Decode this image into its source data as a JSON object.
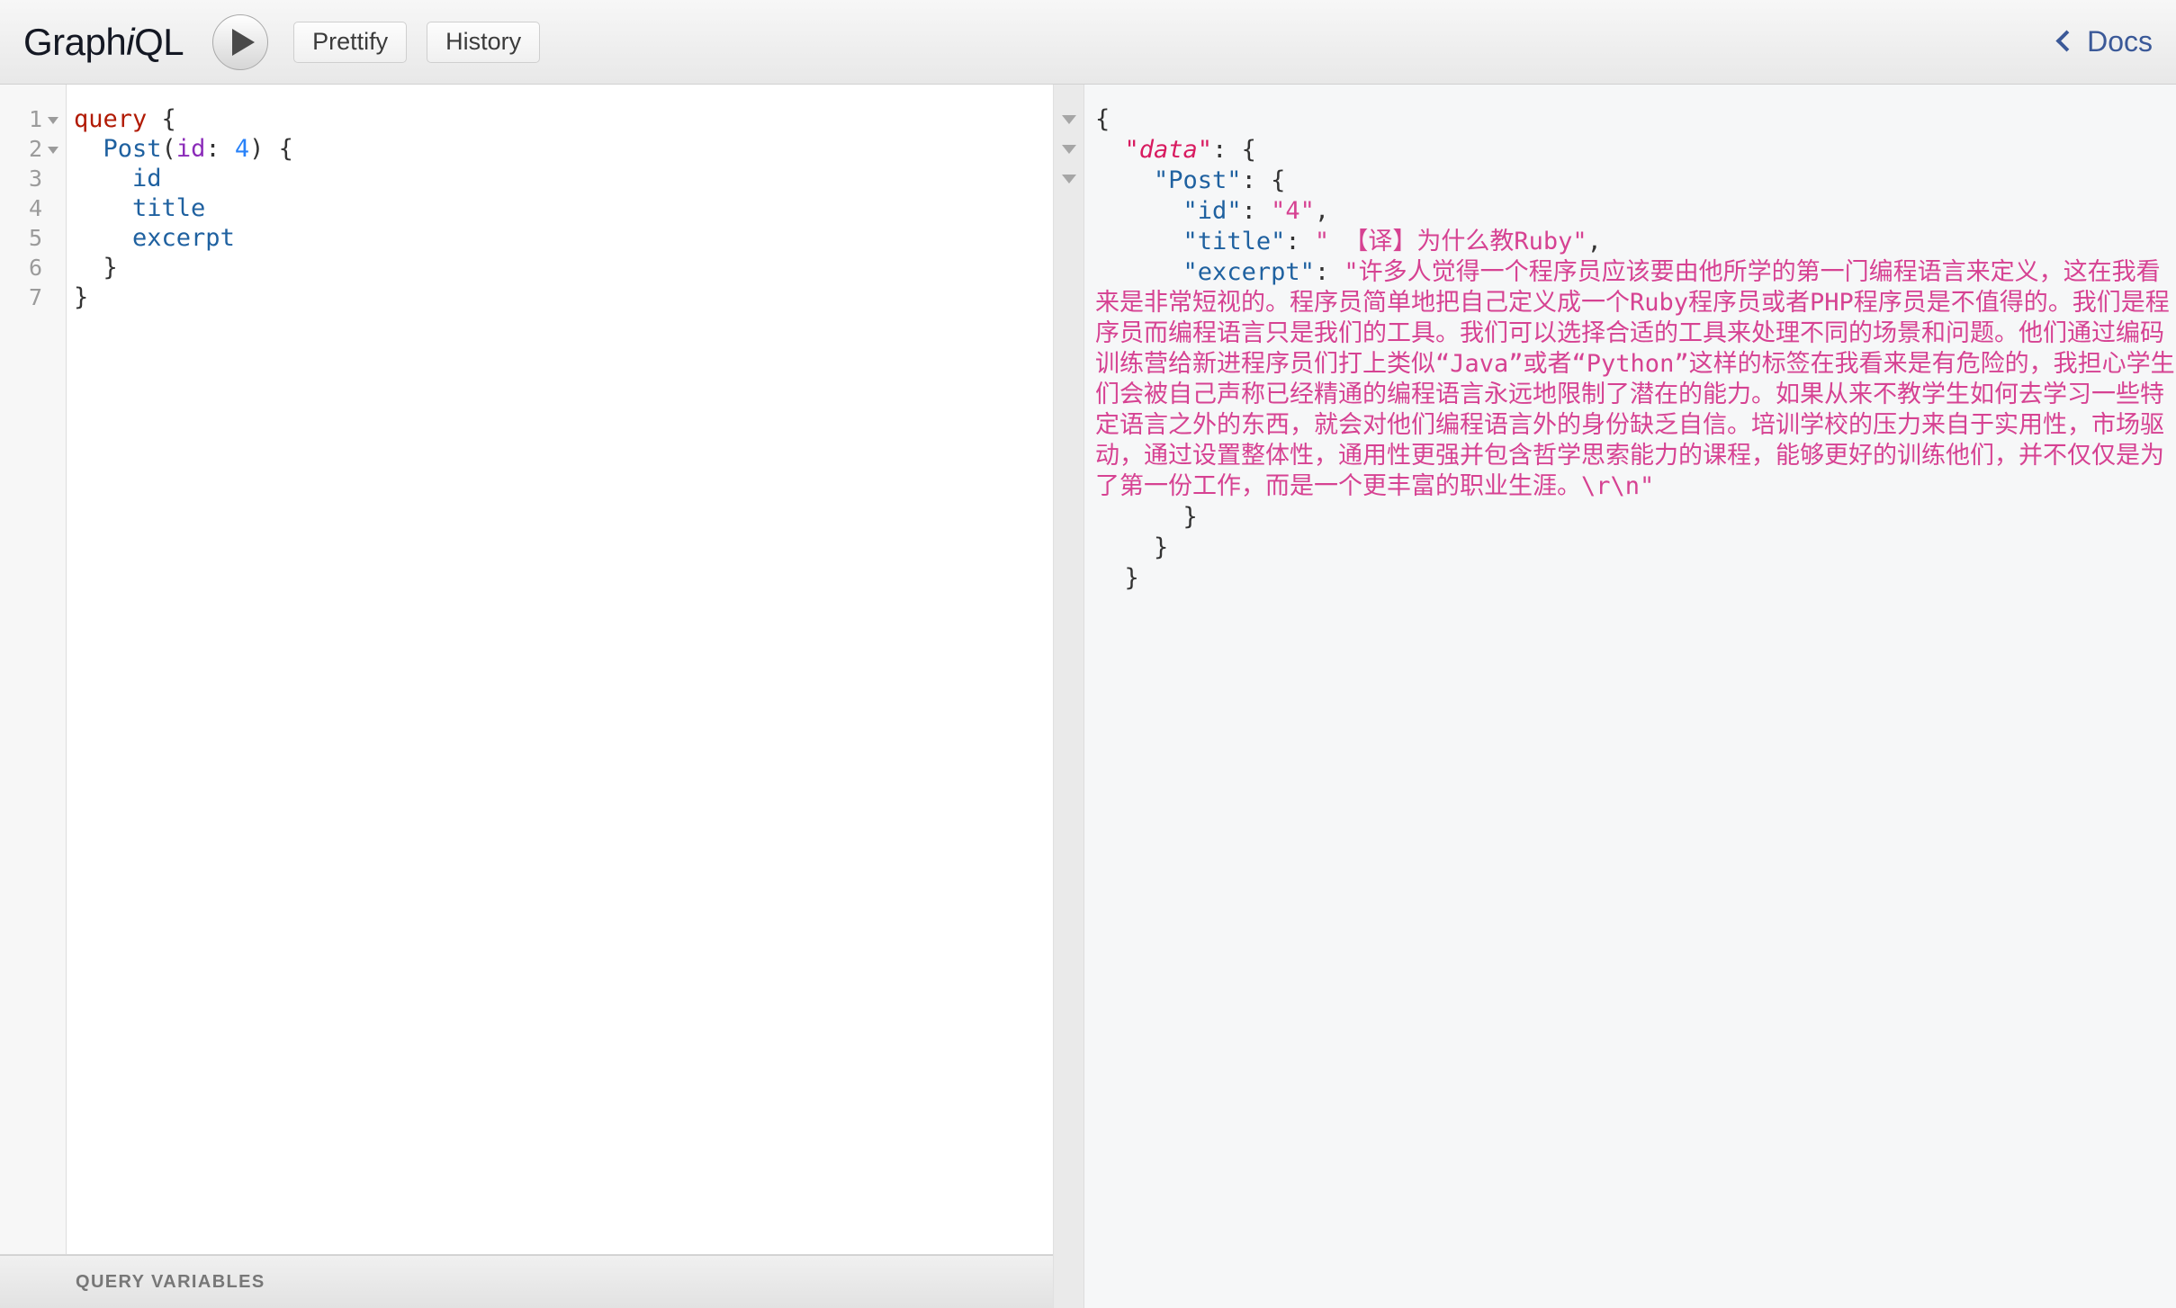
{
  "app": {
    "title_main": "Graph",
    "title_ital": "i",
    "title_tail": "QL"
  },
  "toolbar": {
    "execute_label": "execute-query",
    "prettify_label": "Prettify",
    "history_label": "History",
    "docs_label": "Docs"
  },
  "query_editor": {
    "gutter": [
      "1",
      "2",
      "3",
      "4",
      "5",
      "6",
      "7"
    ],
    "lines": [
      {
        "kw": "query",
        "rest": " {"
      },
      {
        "indent": "  ",
        "def": "Post",
        "punc1": "(",
        "attr": "id",
        "colon": ": ",
        "num": "4",
        "punc2": ") {"
      },
      {
        "indent": "    ",
        "prop": "id"
      },
      {
        "indent": "    ",
        "prop": "title"
      },
      {
        "indent": "    ",
        "prop": "excerpt"
      },
      {
        "indent": "  ",
        "punc": "}"
      },
      {
        "indent": "",
        "punc": "}"
      }
    ],
    "raw": "query {\n  Post(id: 4) {\n    id\n    title\n    excerpt\n  }\n}"
  },
  "query_variables": {
    "label": "QUERY VARIABLES"
  },
  "result": {
    "open_brace": "{",
    "data_key": "\"data\"",
    "data_open": ": {",
    "post_key": "\"Post\"",
    "post_open": ": {",
    "id_key": "\"id\"",
    "id_value": "\"4\"",
    "id_comma": ",",
    "title_key": "\"title\"",
    "title_value": "\" 【译】为什么教Ruby\"",
    "title_comma": ",",
    "excerpt_key": "\"excerpt\"",
    "excerpt_value": "\"许多人觉得一个程序员应该要由他所学的第一门编程语言来定义，这在我看来是非常短视的。程序员简单地把自己定义成一个Ruby程序员或者PHP程序员是不值得的。我们是程序员而编程语言只是我们的工具。我们可以选择合适的工具来处理不同的场景和问题。他们通过编码训练营给新进程序员们打上类似“Java”或者“Python”这样的标签在我看来是有危险的，我担心学生们会被自己声称已经精通的编程语言永远地限制了潜在的能力。如果从来不教学生如何去学习一些特定语言之外的东西，就会对他们编程语言外的身份缺乏自信。培训学校的压力来自于实用性，市场驱动，通过设置整体性，通用性更强并包含哲学思索能力的课程，能够更好的训练他们，并不仅仅是为了第一份工作，而是一个更丰富的职业生涯。\\r\\n\"",
    "close_post": "}",
    "close_data": "}",
    "close_root": "}",
    "fold_markers": [
      "fold-arrow-icon",
      "fold-arrow-icon",
      "fold-arrow-icon"
    ],
    "colons": ": "
  },
  "colors": {
    "keyword_red": "#b11a04",
    "definition_blue": "#1f61a0",
    "attribute_purple": "#8b2bb9",
    "number_blue": "#2882f9",
    "json_key_blue": "#1f61a0",
    "json_data_key_pink": "#d81b60",
    "json_string_pink": "#d64292",
    "docs_link_blue": "#3b5998",
    "result_bg": "#f6f7f8"
  }
}
